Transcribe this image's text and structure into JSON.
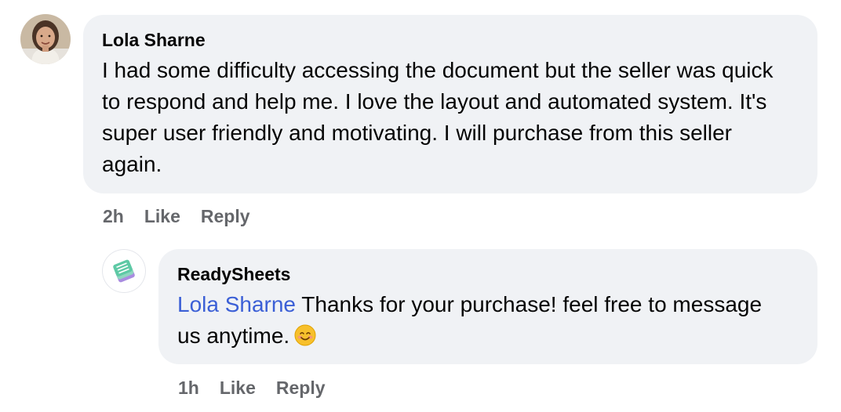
{
  "comment": {
    "author": "Lola Sharne",
    "text": "I had some difficulty accessing the document but the seller was quick to respond and help me. I love the layout and automated system. It's super user friendly and motivating. I will purchase from this seller again.",
    "time": "2h",
    "like_label": "Like",
    "reply_label": "Reply",
    "avatar_icon": "user-photo-avatar"
  },
  "reply": {
    "author": "ReadySheets",
    "mention": "Lola Sharne",
    "text": " Thanks for your purchase! feel free to message us anytime.",
    "emoji": "smiling-face-emoji",
    "time": "1h",
    "like_label": "Like",
    "reply_label": "Reply",
    "avatar_icon": "readysheets-logo-icon"
  },
  "colors": {
    "bubble_bg": "#f0f2f5",
    "mention": "#3b5fd6",
    "meta_text": "#65676b",
    "text": "#050505"
  }
}
